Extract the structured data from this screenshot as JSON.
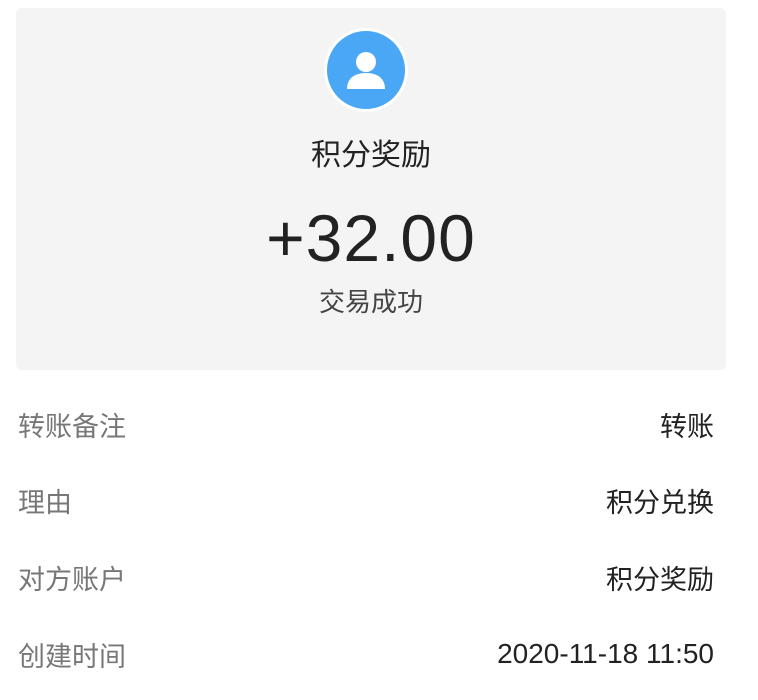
{
  "header": {
    "avatar_icon": "user-avatar-icon",
    "accent_color": "#4aa7f5",
    "title": "积分奖励",
    "amount": "+32.00",
    "status": "交易成功"
  },
  "details": [
    {
      "label": "转账备注",
      "value": "转账"
    },
    {
      "label": "理由",
      "value": "积分兑换"
    },
    {
      "label": "对方账户",
      "value": "积分奖励"
    },
    {
      "label": "创建时间",
      "value": "2020-11-18 11:50"
    }
  ]
}
